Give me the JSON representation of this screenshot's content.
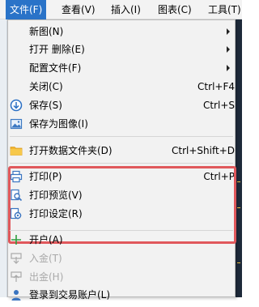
{
  "menubar": {
    "items": [
      {
        "label": "文件(F)"
      },
      {
        "label": "查看(V)"
      },
      {
        "label": "插入(I)"
      },
      {
        "label": "图表(C)"
      },
      {
        "label": "工具(T)"
      }
    ]
  },
  "menu": {
    "items": [
      {
        "label": "新图(N)",
        "accel": "",
        "submenu": true,
        "icon": "none"
      },
      {
        "label": "打开 删除(E)",
        "accel": "",
        "submenu": true,
        "icon": "none"
      },
      {
        "label": "配置文件(F)",
        "accel": "",
        "submenu": true,
        "icon": "none"
      },
      {
        "label": "关闭(C)",
        "accel": "Ctrl+F4",
        "submenu": false,
        "icon": "none"
      },
      {
        "label": "保存(S)",
        "accel": "Ctrl+S",
        "submenu": false,
        "icon": "save-icon"
      },
      {
        "label": "保存为图像(I)",
        "accel": "",
        "submenu": false,
        "icon": "image-icon"
      },
      {
        "label": "打开数据文件夹(D)",
        "accel": "Ctrl+Shift+D",
        "submenu": false,
        "icon": "folder-icon"
      },
      {
        "label": "打印(P)",
        "accel": "Ctrl+P",
        "submenu": false,
        "icon": "printer-icon"
      },
      {
        "label": "打印预览(V)",
        "accel": "",
        "submenu": false,
        "icon": "print-preview-icon"
      },
      {
        "label": "打印设定(R)",
        "accel": "",
        "submenu": false,
        "icon": "print-setup-icon"
      },
      {
        "label": "开户(A)",
        "accel": "",
        "submenu": false,
        "icon": "plus-icon"
      },
      {
        "label": "入金(T)",
        "accel": "",
        "submenu": false,
        "icon": "deposit-icon",
        "disabled": true
      },
      {
        "label": "出金(H)",
        "accel": "",
        "submenu": false,
        "icon": "withdraw-icon",
        "disabled": true
      },
      {
        "label": "登录到交易账户(L)",
        "accel": "",
        "submenu": false,
        "icon": "user-icon"
      }
    ]
  },
  "colors": {
    "menubar_active": "#2a73c8",
    "highlight_box": "#e0585c",
    "menu_bg": "#f2f2f2",
    "plus_icon": "#2e9e3e"
  }
}
